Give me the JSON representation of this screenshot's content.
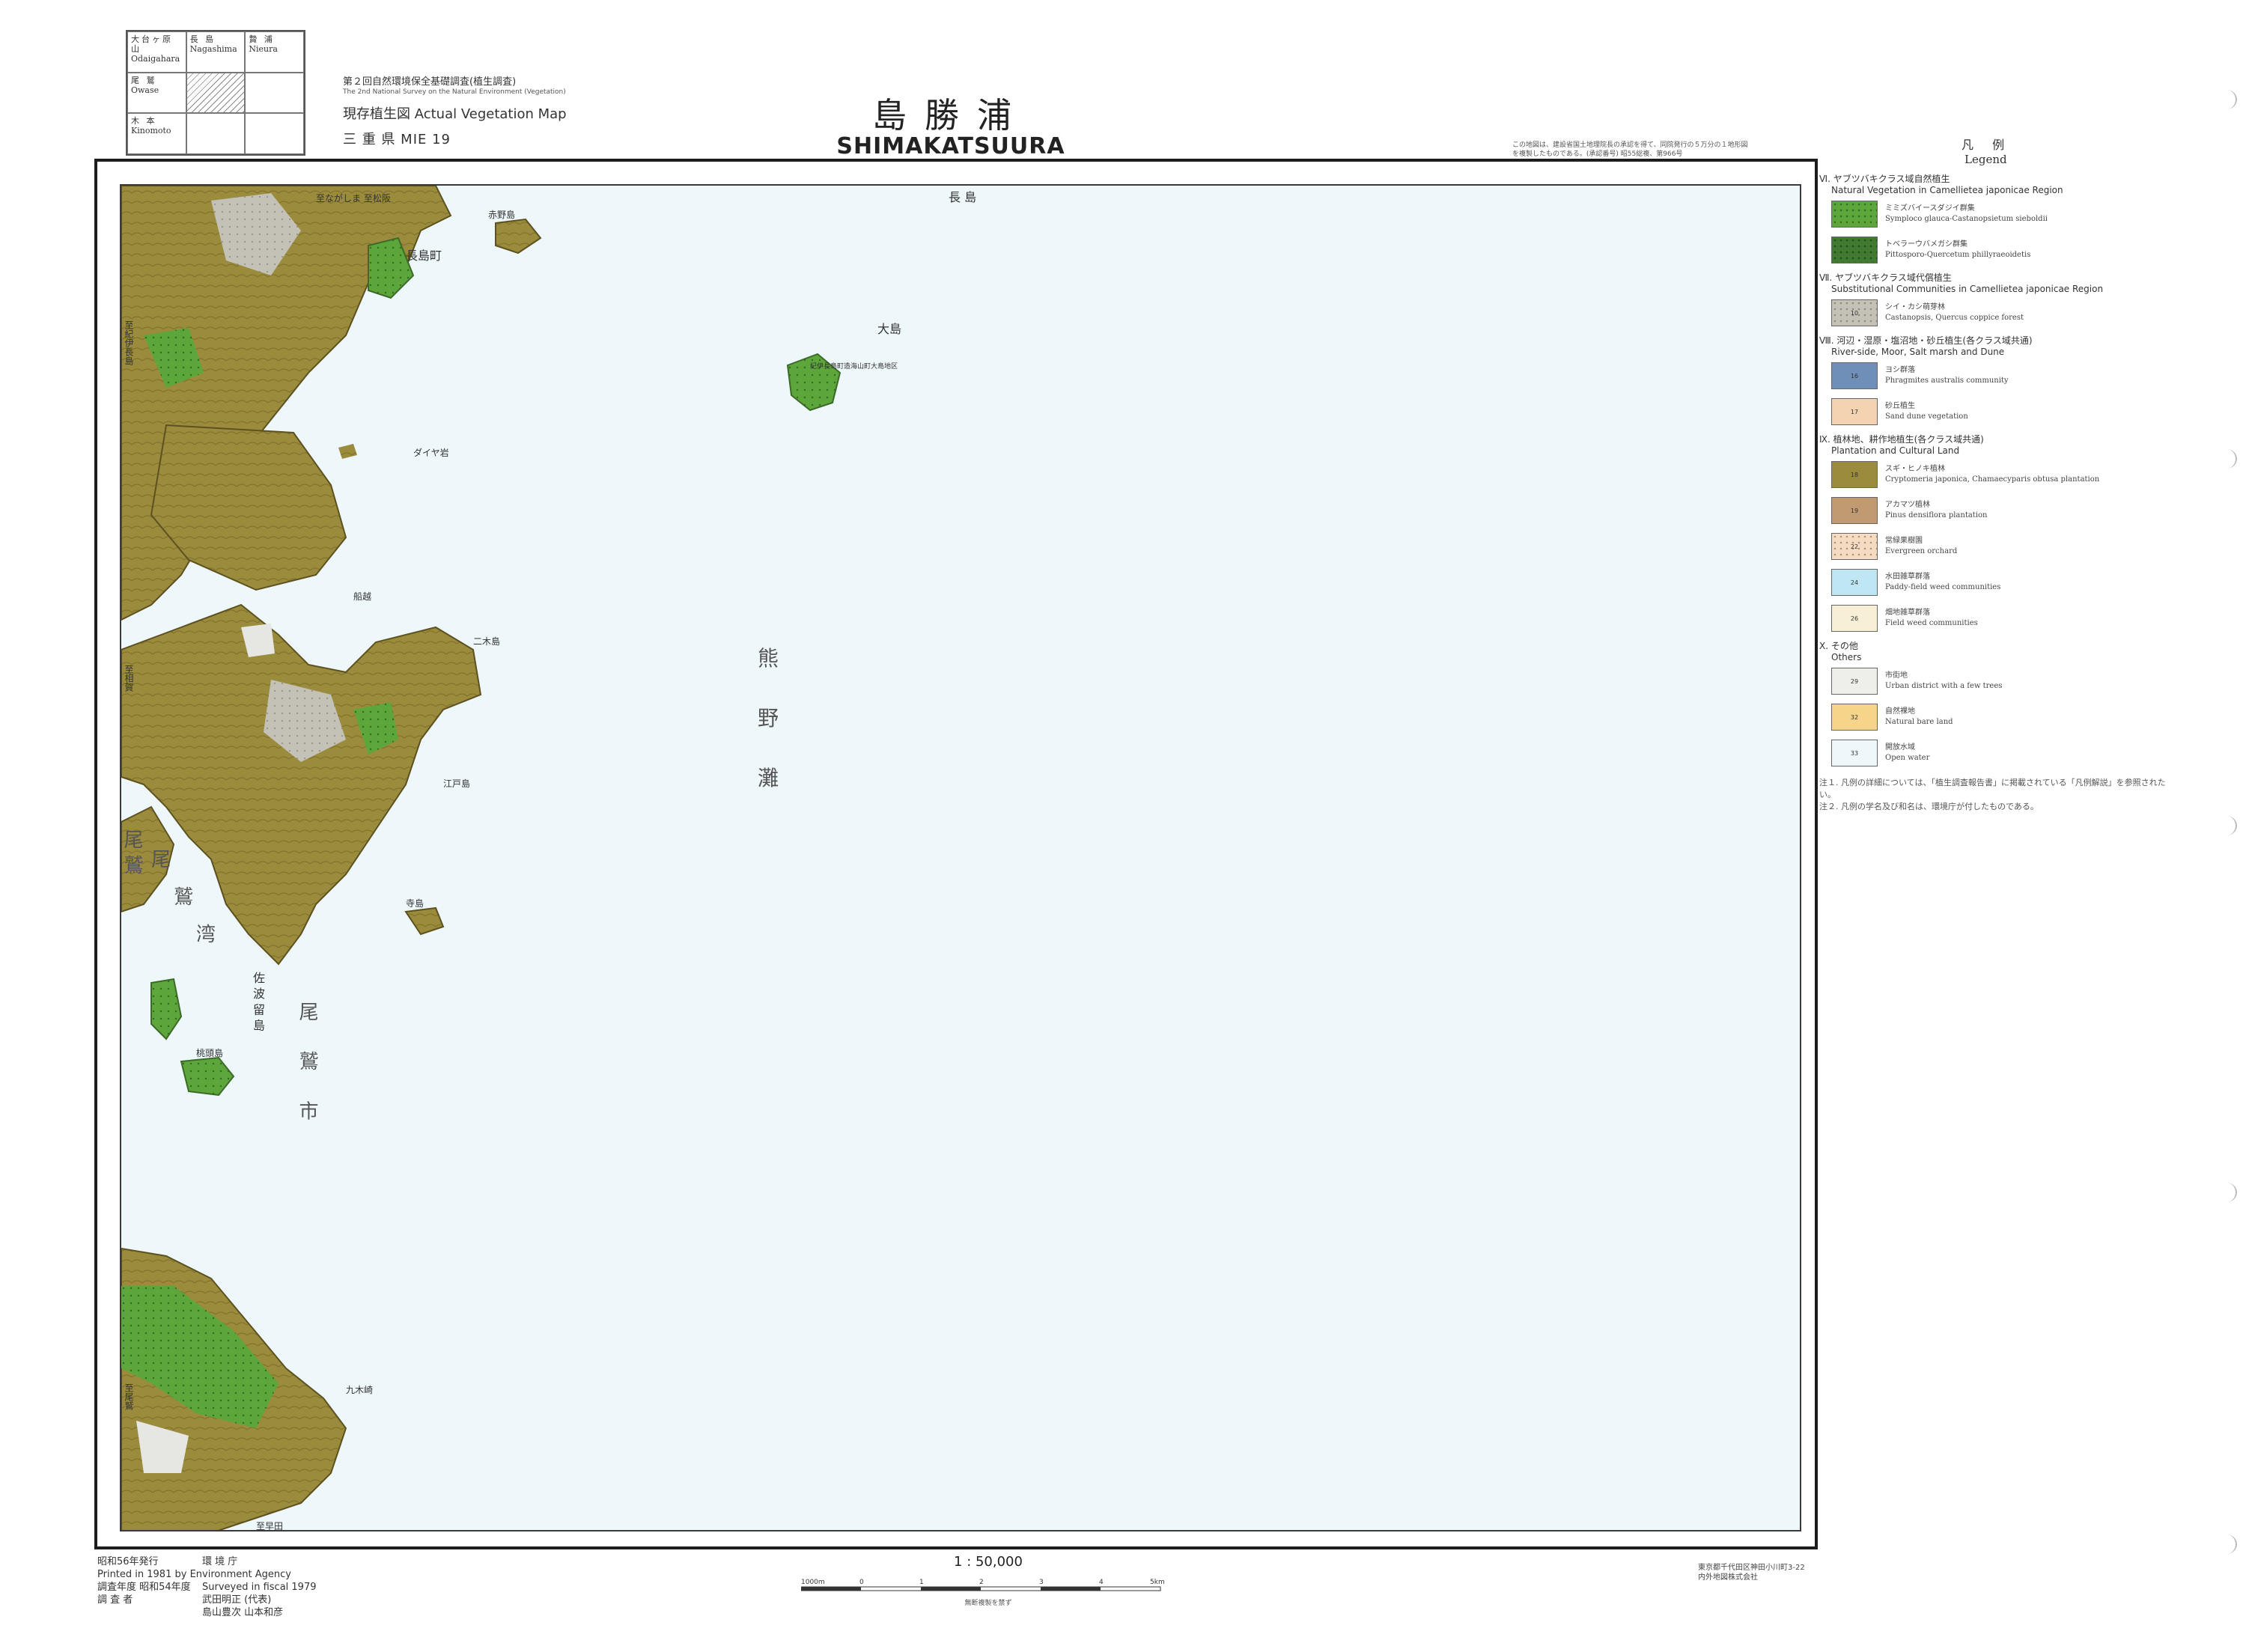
{
  "index_map": {
    "cells": [
      {
        "jp": "大台ヶ原山",
        "en": "Odaigahara"
      },
      {
        "jp": "長 島",
        "en": "Nagashima"
      },
      {
        "jp": "贄 浦",
        "en": "Nieura"
      },
      {
        "jp": "尾 鷲",
        "en": "Owase"
      },
      {
        "jp": "",
        "en": ""
      },
      {
        "jp": "",
        "en": ""
      },
      {
        "jp": "木 本",
        "en": "Kinomoto"
      },
      {
        "jp": "",
        "en": ""
      },
      {
        "jp": "",
        "en": ""
      }
    ]
  },
  "header": {
    "survey_jp": "第２回自然環境保全基礎調査(植生調査)",
    "survey_en": "The 2nd National Survey on the Natural Environment (Vegetation)",
    "series": "現存植生図 Actual Vegetation Map",
    "prefecture": "三 重 県  MIE 19",
    "title_jp": "島勝浦",
    "title_en": "SHIMAKATSUURA"
  },
  "note_top": "この地図は、建設省国土地理院長の承認を得て、同院発行の５万分の１地形図を複製したものである。(承認番号) 昭55総複、第966号",
  "map": {
    "sheet_name_top": "長 島",
    "sea_name_chars": [
      "熊",
      "野",
      "灘"
    ],
    "bay_name_chars": [
      "尾",
      "鷲",
      "湾"
    ],
    "labels": {
      "nagashima_town": "長島町",
      "akano_island": "赤野島",
      "oshima": "大島",
      "funatsu": "船越",
      "edo_island": "江戸島",
      "tera_island": "寺島",
      "owase_city": "尾 鷲 市",
      "owase_vert": "尾 鷲",
      "sasuri_island": "佐 波 留 島",
      "momotori_island": "桃頭島",
      "futatsu_island": "二木島",
      "daiya_rock": "ダイヤ岩",
      "oshima_note": "紀伊長島町造海山町大島地区",
      "kukizaki": "九木崎",
      "edge_top_left": "至ながしま 至松阪",
      "edge_left_1": "至紀伊長島",
      "edge_left_2": "至相賀",
      "edge_left_3": "至尾鷲",
      "edge_bottom": "至早田"
    }
  },
  "legend": {
    "heading_jp": "凡 例",
    "heading_en": "Legend",
    "groups": [
      {
        "title_jp": "Ⅵ. ヤブツバキクラス域自然植生",
        "title_en": "Natural Vegetation in Camellietea japonicae Region",
        "items": [
          {
            "code": "",
            "jp": "ミミズバイースダジイ群集",
            "en": "Symploco glauca-Castanopsietum sieboldii",
            "color": "#5da63c",
            "pattern": "dots"
          },
          {
            "code": "",
            "jp": "トベラーウバメガシ群集",
            "en": "Pittosporo-Quercetum phillyraeoidetis",
            "color": "#3f7a2e",
            "pattern": "dots"
          }
        ]
      },
      {
        "title_jp": "Ⅶ. ヤブツバキクラス域代償植生",
        "title_en": "Substitutional Communities in Camellietea japonicae Region",
        "items": [
          {
            "code": "10",
            "jp": "シイ・カシ萌芽林",
            "en": "Castanopsis, Quercus coppice forest",
            "color": "#c4c1b7",
            "pattern": "dots"
          }
        ]
      },
      {
        "title_jp": "Ⅷ. 河辺・湿原・塩沼地・砂丘植生(各クラス域共通)",
        "title_en": "River-side, Moor, Salt marsh and Dune",
        "items": [
          {
            "code": "16",
            "jp": "ヨシ群落",
            "en": "Phragmites australis community",
            "color": "#6f8fb8",
            "pattern": "none"
          },
          {
            "code": "17",
            "jp": "砂丘植生",
            "en": "Sand dune vegetation",
            "color": "#f4d3b3",
            "pattern": "none"
          }
        ]
      },
      {
        "title_jp": "Ⅸ. 植林地、耕作地植生(各クラス域共通)",
        "title_en": "Plantation and Cultural Land",
        "items": [
          {
            "code": "18",
            "jp": "スギ・ヒノキ植林",
            "en": "Cryptomeria japonica, Chamaecyparis obtusa plantation",
            "color": "#9b8b3c",
            "pattern": "none"
          },
          {
            "code": "19",
            "jp": "アカマツ植林",
            "en": "Pinus densiflora plantation",
            "color": "#c29a72",
            "pattern": "none"
          },
          {
            "code": "22",
            "jp": "常緑果樹園",
            "en": "Evergreen orchard",
            "color": "#f3dcc3",
            "pattern": "dots"
          },
          {
            "code": "24",
            "jp": "水田雑草群落",
            "en": "Paddy-field weed communities",
            "color": "#bfe6f3",
            "pattern": "none"
          },
          {
            "code": "26",
            "jp": "畑地雑草群落",
            "en": "Field weed communities",
            "color": "#f7f0d6",
            "pattern": "none"
          }
        ]
      },
      {
        "title_jp": "Ⅹ. その他",
        "title_en": "Others",
        "items": [
          {
            "code": "29",
            "jp": "市街地",
            "en": "Urban district with a few trees",
            "color": "#eeeeea",
            "pattern": "none"
          },
          {
            "code": "32",
            "jp": "自然裸地",
            "en": "Natural bare land",
            "color": "#f6d58a",
            "pattern": "none"
          },
          {
            "code": "33",
            "jp": "開放水域",
            "en": "Open water",
            "color": "#eef7fa",
            "pattern": "none"
          }
        ]
      }
    ],
    "notes": [
      "注１. 凡例の詳細については、「植生調査報告書」に掲載されている「凡例解説」を参照されたい。",
      "注２. 凡例の学名及び和名は、環境庁が付したものである。"
    ]
  },
  "footer": {
    "published_jp": "昭和56年発行",
    "publisher_jp": "環 境 庁",
    "printed": "Printed in 1981 by Environment Agency",
    "surveyed_jp": "調査年度  昭和54年度",
    "surveyed_en": "Surveyed in fiscal 1979",
    "surveyors_label": "調 査 者",
    "surveyors": "武田明正 (代表)",
    "surveyors_2": "島山豊次  山本和彦",
    "scale": "1 : 50,000",
    "scale_note": "無断複製を禁ず",
    "scale_ticks": [
      "1000m",
      "0",
      "1",
      "2",
      "3",
      "4",
      "5km"
    ],
    "printer_1": "東京都千代田区神田小川町3-22",
    "printer_2": "内外地図株式会社"
  },
  "colors": {
    "plantation": "#9b8b3c",
    "natural_forest": "#5da63c",
    "coppice": "#c4c1b7",
    "sea": "#eef7fa",
    "urban": "#e6e6e2",
    "pine": "#c29a72"
  }
}
